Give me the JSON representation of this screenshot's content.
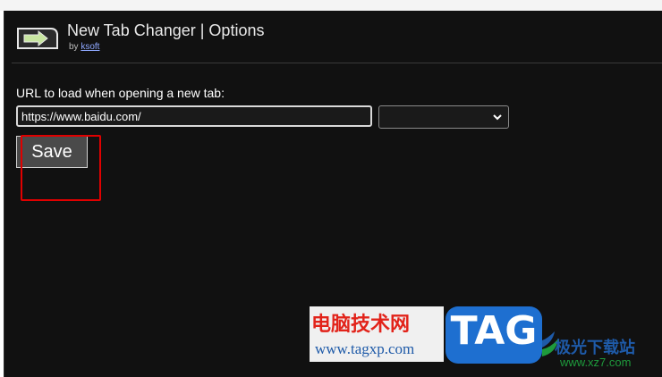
{
  "header": {
    "title": "New Tab Changer | Options",
    "by_prefix": "by",
    "author": "ksoft"
  },
  "form": {
    "url_label": "URL to load when opening a new tab:",
    "url_value": "https://www.baidu.com/",
    "select_value": "",
    "save_label": "Save"
  },
  "watermark": {
    "cn_text": "电脑技术网",
    "url_text": "www.tagxp.com",
    "tag_text": "TAG",
    "side_cn": "极光下载站",
    "side_url": "www.xz7.com"
  },
  "colors": {
    "panel_bg": "#111111",
    "highlight": "#e00000",
    "link": "#8fa8ff"
  }
}
